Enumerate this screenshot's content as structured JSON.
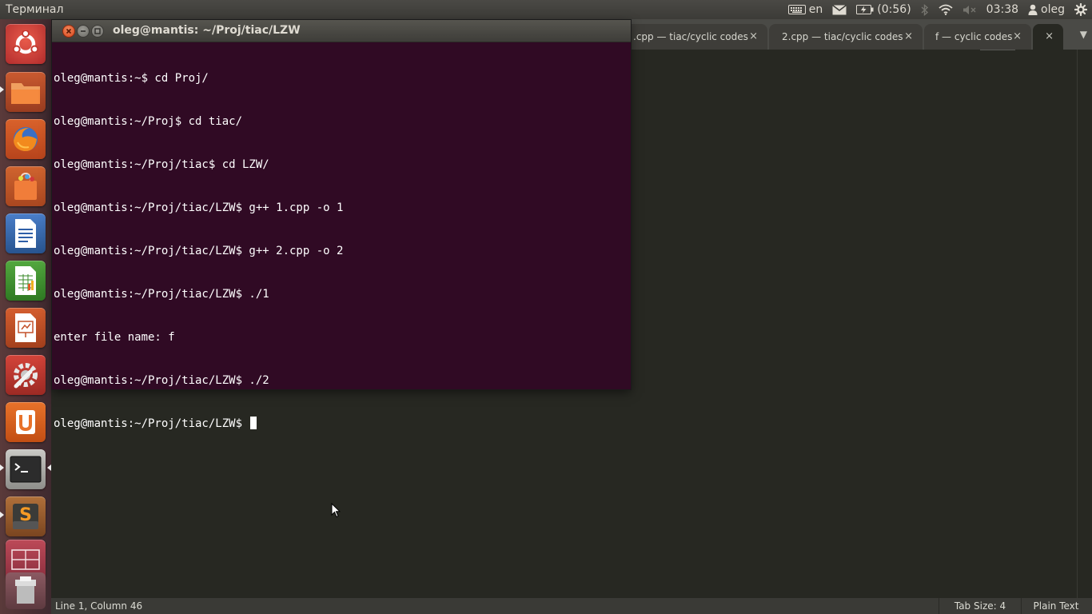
{
  "top_panel": {
    "app_name": "Терминал",
    "keyboard_layout": "en",
    "battery_time": "(0:56)",
    "clock": "03:38",
    "user": "oleg"
  },
  "launcher": {
    "items": [
      "ubuntu-dash",
      "files",
      "firefox",
      "software-center",
      "writer",
      "calc",
      "impress",
      "system-settings",
      "ubuntu-one",
      "terminal",
      "sublime-text",
      "workspace-switcher",
      "trash"
    ]
  },
  "editor": {
    "tabs": [
      {
        "label": ".cpp — tiac/cyclic codes"
      },
      {
        "label": "2.cpp — tiac/cyclic codes"
      },
      {
        "label": "f — cyclic codes"
      },
      {
        "label": ""
      }
    ],
    "close_glyph": "×",
    "overflow_glyph": "▼"
  },
  "status_bar": {
    "position": "Line 1, Column 46",
    "tab_size": "Tab Size: 4",
    "syntax": "Plain Text"
  },
  "terminal": {
    "title": "oleg@mantis: ~/Proj/tiac/LZW",
    "lines": [
      "oleg@mantis:~$ cd Proj/",
      "oleg@mantis:~/Proj$ cd tiac/",
      "oleg@mantis:~/Proj/tiac$ cd LZW/",
      "oleg@mantis:~/Proj/tiac/LZW$ g++ 1.cpp -o 1",
      "oleg@mantis:~/Proj/tiac/LZW$ g++ 2.cpp -o 2",
      "oleg@mantis:~/Proj/tiac/LZW$ ./1",
      "enter file name: f",
      "oleg@mantis:~/Proj/tiac/LZW$ ./2",
      "oleg@mantis:~/Proj/tiac/LZW$ "
    ]
  },
  "colors": {
    "terminal_bg": "#300a24",
    "editor_bg": "#272822",
    "panel_bg": "#3c3b37",
    "close_button": "#e25c2b"
  }
}
